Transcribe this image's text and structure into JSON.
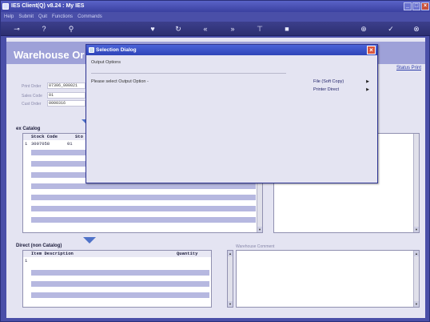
{
  "window": {
    "title": "IES Client(Q) v8.24 : My IES"
  },
  "menu": [
    "Help",
    "Submit",
    "Quit",
    "Functions",
    "Commands"
  ],
  "banner": {
    "title": "Warehouse Or"
  },
  "status_print": "Status Print",
  "order_fields": [
    {
      "label": "Print Order",
      "value": "07306_000021"
    },
    {
      "label": "Sales Code",
      "value": "01"
    },
    {
      "label": "Cust Order",
      "value": "0000316"
    }
  ],
  "catalog": {
    "heading": "ex Catalog",
    "columns": [
      "Stock Code",
      "Sto"
    ],
    "rows": [
      {
        "num": "1",
        "stock_code": "3007058",
        "store": "01"
      }
    ]
  },
  "non_catalog": {
    "heading": "Direct (non Catalog)",
    "columns": [
      "Item Description",
      "Quantity"
    ],
    "rows": [
      {
        "num": "1"
      }
    ]
  },
  "warehouse_comment": {
    "label": "Warehouse Comment"
  },
  "dialog": {
    "title": "Selection Dialog",
    "section": "Output Options",
    "prompt": "Please select Output Option -",
    "options": [
      "File (Soft Copy)",
      "Printer Direct"
    ]
  }
}
